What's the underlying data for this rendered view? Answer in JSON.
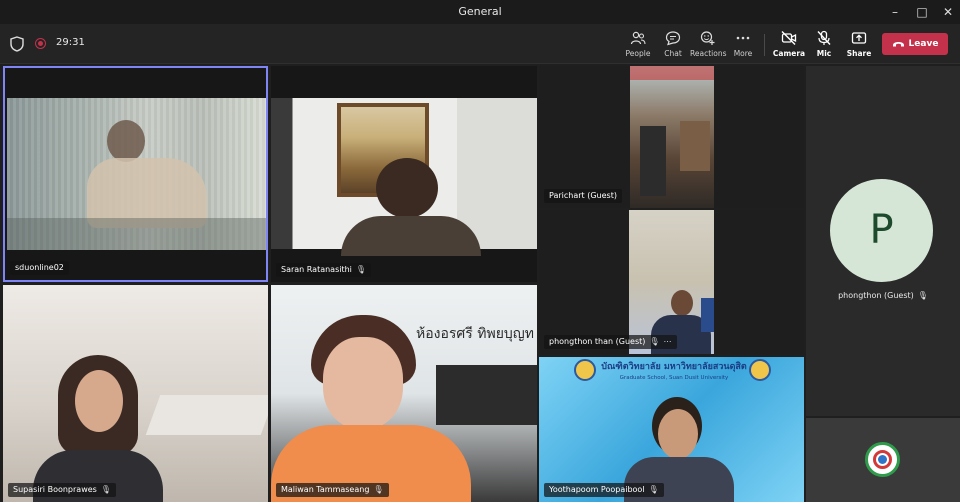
{
  "window": {
    "title": "General"
  },
  "toolbar": {
    "timer": "29:31",
    "people_label": "People",
    "chat_label": "Chat",
    "reactions_label": "Reactions",
    "more_label": "More",
    "camera_label": "Camera",
    "mic_label": "Mic",
    "share_label": "Share",
    "leave_label": "Leave"
  },
  "participants": [
    {
      "name": "sduonline02"
    },
    {
      "name": "Saran Ratanasithi"
    },
    {
      "name": "Parichart (Guest)"
    },
    {
      "name": "phongthon than (Guest)"
    },
    {
      "name": "Supasiri Boonprawes"
    },
    {
      "name": "Maliwan Tammaseang"
    },
    {
      "name": "Yoothapoom Poopaibool"
    }
  ],
  "avatar_tile": {
    "initial": "P",
    "name": "phongthon (Guest)"
  },
  "banner": {
    "thai": "บัณฑิตวิทยาลัย มหาวิทยาลัยสวนดุสิต",
    "english": "Graduate School, Suan Dusit University"
  },
  "room_sign": "ห้องอรศรี ทิพยบุญท",
  "colors": {
    "accent": "#6264a7",
    "leave": "#c4314b",
    "background": "#1f1f1f"
  }
}
